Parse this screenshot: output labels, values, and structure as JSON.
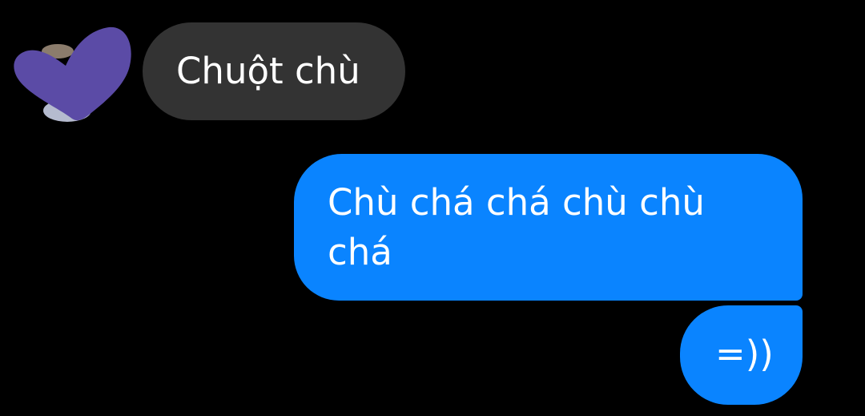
{
  "conversation": {
    "messages": [
      {
        "direction": "incoming",
        "text": "Chuột chù"
      },
      {
        "direction": "outgoing",
        "text": "Chù chá chá chù chù chá"
      },
      {
        "direction": "outgoing",
        "text": "=))"
      }
    ]
  },
  "avatar": {
    "icon": "heart-icon",
    "overlay_color": "#5b4ba6"
  },
  "colors": {
    "background": "#000000",
    "incoming_bubble": "#333333",
    "outgoing_bubble": "#0a84ff",
    "text": "#ffffff"
  }
}
